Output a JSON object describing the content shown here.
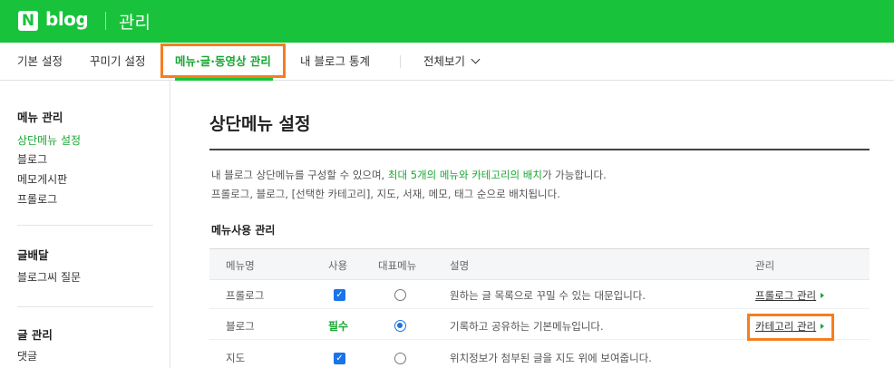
{
  "header": {
    "logo_letter": "N",
    "logo_text": "blog",
    "title": "관리"
  },
  "tabs": [
    {
      "label": "기본 설정"
    },
    {
      "label": "꾸미기 설정"
    },
    {
      "label": "메뉴·글·동영상 관리"
    },
    {
      "label": "내 블로그 통계"
    },
    {
      "label": "전체보기"
    }
  ],
  "sidebar": {
    "sections": [
      {
        "heading": "메뉴 관리",
        "items": [
          "상단메뉴 설정",
          "블로그",
          "메모게시판",
          "프롤로그"
        ]
      },
      {
        "heading": "글배달",
        "items": [
          "블로그씨 질문"
        ]
      },
      {
        "heading": "글 관리",
        "items": [
          "댓글"
        ]
      }
    ]
  },
  "main": {
    "title": "상단메뉴 설정",
    "desc_line1_pre": "내 블로그 상단메뉴를 구성할 수 있으며, ",
    "desc_line1_hl": "최대 5개의 메뉴와 카테고리의 배치",
    "desc_line1_post": "가 가능합니다.",
    "desc_line2": "프롤로그, 블로그, [선택한 카테고리], 지도, 서재, 메모, 태그 순으로 배치됩니다.",
    "section_title": "메뉴사용 관리",
    "table": {
      "headers": [
        "메뉴명",
        "사용",
        "대표메뉴",
        "설명",
        "관리"
      ],
      "rows": [
        {
          "name": "프롤로그",
          "use": "checked",
          "rep": false,
          "desc": "원하는 글 목록으로 꾸밀 수 있는 대문입니다.",
          "manage": "프롤로그 관리"
        },
        {
          "name": "블로그",
          "use": "필수",
          "rep": true,
          "desc": "기록하고 공유하는 기본메뉴입니다.",
          "manage": "카테고리 관리"
        },
        {
          "name": "지도",
          "use": "checked",
          "rep": false,
          "desc": "위치정보가 첨부된 글을 지도 위에 보여줍니다.",
          "manage": ""
        }
      ]
    }
  },
  "colors": {
    "brand_green": "#18c33b",
    "active_green": "#18a832",
    "highlight_orange": "#f57e20",
    "checkbox_blue": "#1a73e8"
  }
}
